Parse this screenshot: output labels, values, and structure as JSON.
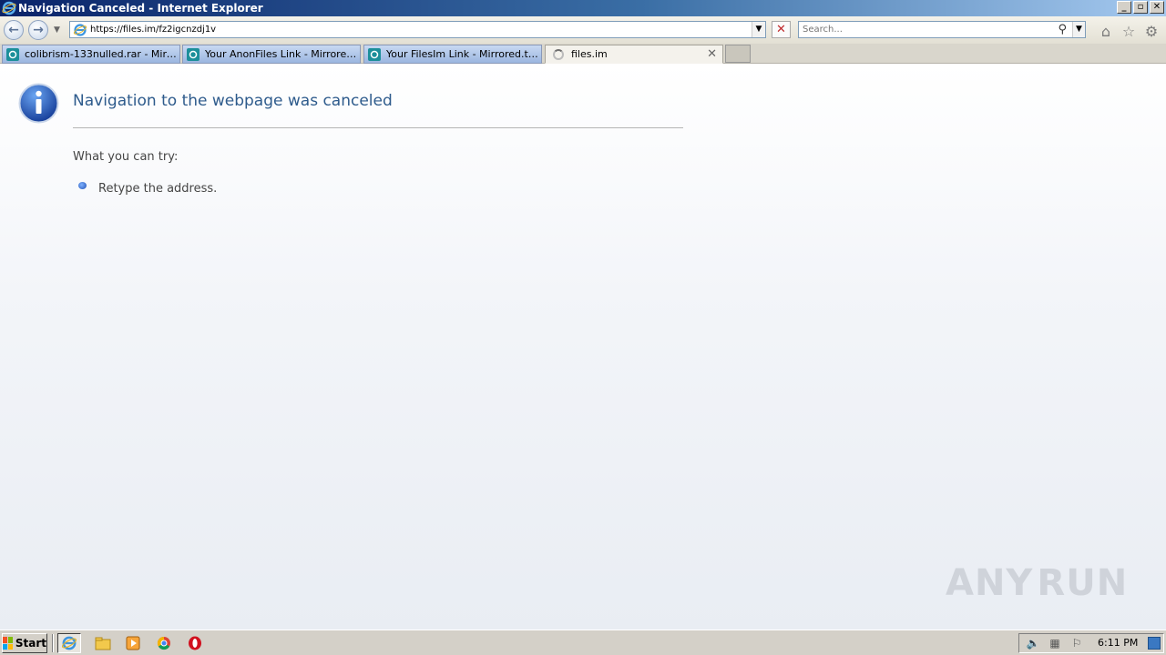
{
  "window": {
    "title": "Navigation Canceled - Internet Explorer"
  },
  "toolbar": {
    "address_url": "https://files.im/fz2igcnzdj1v",
    "search_placeholder": "Search..."
  },
  "tabs": [
    {
      "label": "colibrism-133nulled.rar - Mirrore...",
      "active": false
    },
    {
      "label": "Your AnonFiles Link - Mirrored.t...",
      "active": false
    },
    {
      "label": "Your FilesIm Link - Mirrored.to - ...",
      "active": false
    },
    {
      "label": "files.im",
      "active": true
    }
  ],
  "page": {
    "headline": "Navigation to the webpage was canceled",
    "try_label": "What you can try:",
    "tips": [
      "Retype the address."
    ]
  },
  "watermark": {
    "left": "ANY",
    "right": "RUN"
  },
  "taskbar": {
    "start_label": "Start",
    "apps": [
      "internet-explorer",
      "windows-explorer",
      "media-player",
      "chrome",
      "opera"
    ],
    "clock": "6:11 PM"
  },
  "colors": {
    "headline": "#2e5b8c",
    "titlebar_start": "#0a246a",
    "titlebar_end": "#a6caf0"
  }
}
